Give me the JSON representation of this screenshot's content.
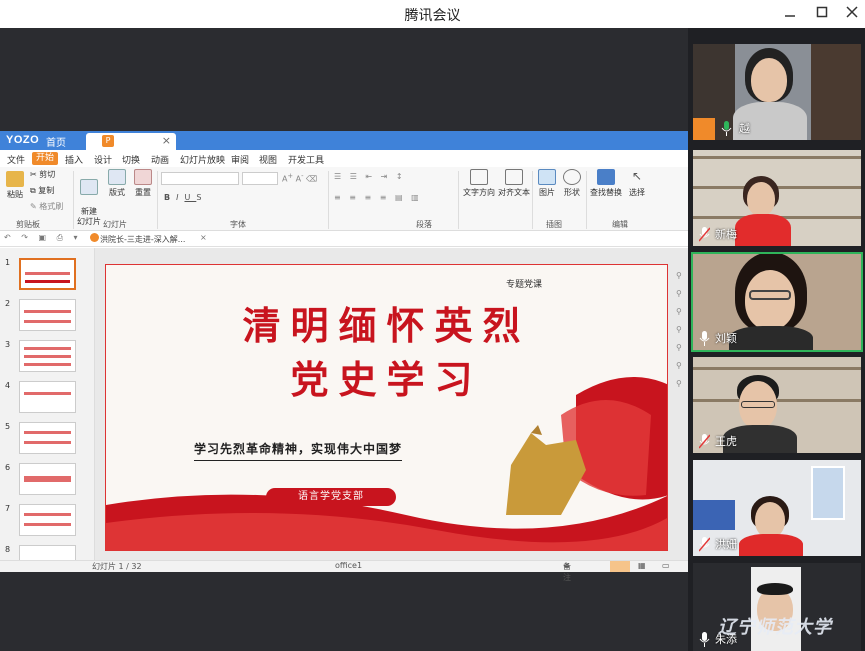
{
  "window": {
    "title": "腾讯会议"
  },
  "app": {
    "logo": "YOZO",
    "home_tab": "首页",
    "doc_tab_close": "×",
    "menu": [
      "文件",
      "开始",
      "插入",
      "设计",
      "切换",
      "动画",
      "幻灯片放映",
      "审阅",
      "视图",
      "开发工具"
    ],
    "menu_active_index": 1,
    "ribbon": {
      "paste": "粘贴",
      "cut": "剪切",
      "copy": "复制",
      "format_painter": "格式刷",
      "clipboard_group": "剪贴板",
      "new_slide": "新建\n幻灯片",
      "layout": "版式",
      "reset": "重置",
      "slides_group": "幻灯片",
      "font_group": "字体",
      "paragraph_group": "段落",
      "text_direction": "文字方向",
      "align_text": "对齐文本",
      "picture": "图片",
      "shape": "形状",
      "drawing_group": "插图",
      "find_replace": "查找替换",
      "select": "选择",
      "edit_group": "编辑"
    },
    "doc_label": "洪院长-三走进-深入解...",
    "thumbnails": [
      "1",
      "2",
      "3",
      "4",
      "5",
      "6",
      "7",
      "8"
    ],
    "slide": {
      "tag": "专题党课",
      "title_line1": "清明缅怀英烈",
      "title_line2": "党史学习",
      "motto": "学习先烈革命精神，实现伟大中国梦",
      "dept": "语言学党支部"
    },
    "status": {
      "slide_counter": "幻灯片 1 / 32",
      "theme": "office1",
      "notes": "备注"
    }
  },
  "participants": [
    {
      "name": "越"
    },
    {
      "name": "新梅"
    },
    {
      "name": "刘颖"
    },
    {
      "name": "王虎"
    },
    {
      "name": "洪姗"
    },
    {
      "name": "朱添"
    }
  ],
  "watermark": "辽宁师范大学",
  "colors": {
    "ribbon_blue": "#3f82d9",
    "accent_orange": "#f08a2a",
    "slide_red": "#c8141e",
    "speaking_green": "#2fb45a"
  }
}
